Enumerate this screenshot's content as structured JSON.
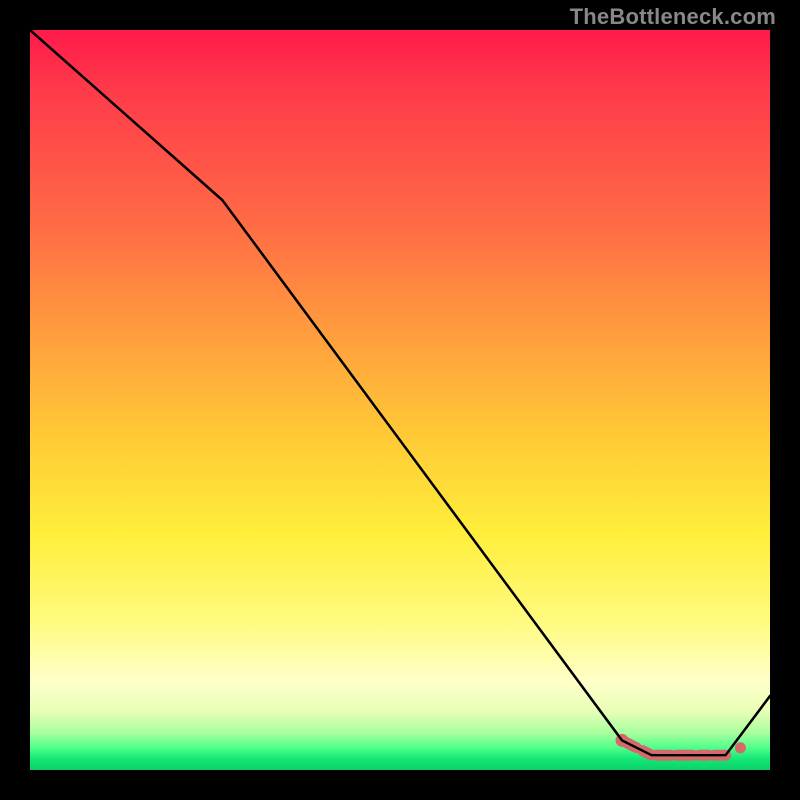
{
  "watermark": "TheBottleneck.com",
  "colors": {
    "line": "#000000",
    "marker_fill": "#d46a6a",
    "marker_stroke": "#b24e4e",
    "gradient_top": "#ff1a4b",
    "gradient_bottom": "#0bd06a"
  },
  "chart_data": {
    "type": "line",
    "title": "",
    "xlabel": "",
    "ylabel": "",
    "xlim": [
      0,
      100
    ],
    "ylim": [
      0,
      100
    ],
    "grid": false,
    "legend": false,
    "series": [
      {
        "name": "curve",
        "x": [
          0,
          26,
          80,
          82,
          84,
          86,
          88,
          90,
          92,
          94,
          100
        ],
        "values": [
          100,
          77,
          4,
          3,
          2,
          2,
          2,
          2,
          2,
          2,
          10
        ]
      }
    ],
    "markers": {
      "name": "highlight-segment",
      "color": "#d46a6a",
      "points": [
        {
          "x": 80,
          "y": 4
        },
        {
          "x": 82,
          "y": 3
        },
        {
          "x": 84,
          "y": 2
        },
        {
          "x": 86,
          "y": 2
        },
        {
          "x": 88,
          "y": 2
        },
        {
          "x": 90,
          "y": 2
        },
        {
          "x": 92,
          "y": 2
        },
        {
          "x": 94,
          "y": 2
        }
      ]
    }
  }
}
